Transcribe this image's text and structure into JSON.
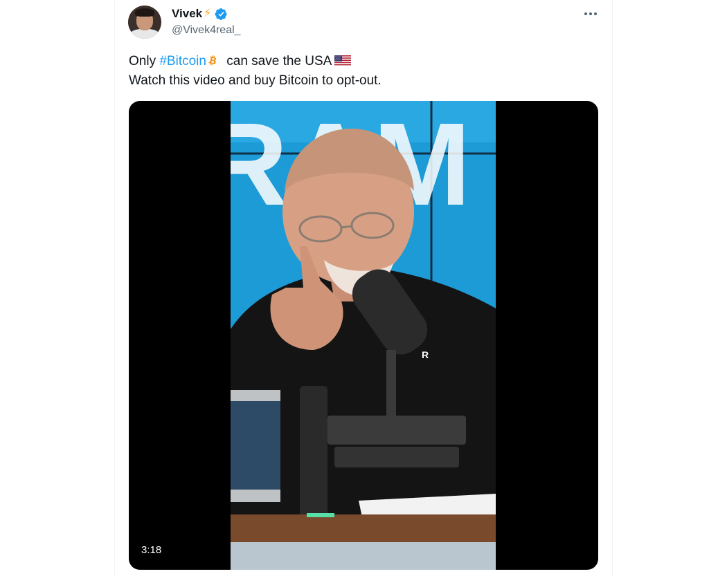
{
  "author": {
    "display_name": "Vivek",
    "handle": "@Vivek4real_",
    "verified": true
  },
  "tweet": {
    "text_part1": "Only ",
    "hashtag": "#Bitcoin",
    "text_part2": " can save the USA",
    "line2": "Watch this video and buy Bitcoin to opt-out."
  },
  "media": {
    "duration": "3:18",
    "backdrop_text": "RAM",
    "mic_logo": "R"
  },
  "icons": {
    "more": "more-horizontal-icon",
    "verified": "verified-badge-icon",
    "bolt": "lightning-bolt-icon",
    "bitcoin": "bitcoin-icon",
    "flag": "us-flag-icon"
  },
  "colors": {
    "accent": "#1d9bf0",
    "text": "#0f1419",
    "secondary": "#536471",
    "bitcoin": "#f7931a"
  }
}
